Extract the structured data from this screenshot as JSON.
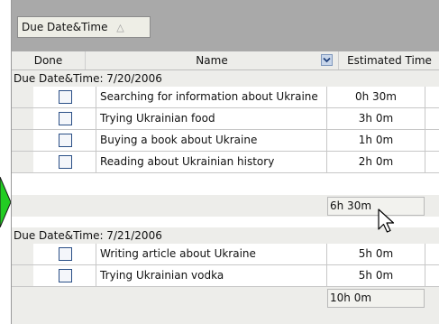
{
  "group_panel": {
    "chip_label": "Due Date&Time"
  },
  "columns": {
    "done": "Done",
    "name": "Name",
    "estimated": "Estimated Time"
  },
  "groups": [
    {
      "label": "Due Date&Time: 7/20/2006",
      "rows": [
        {
          "name": "Searching for information about Ukraine",
          "estimated": "0h 30m"
        },
        {
          "name": "Trying Ukrainian food",
          "estimated": "3h 0m"
        },
        {
          "name": "Buying a book about Ukraine",
          "estimated": "1h 0m"
        },
        {
          "name": "Reading about Ukrainian history",
          "estimated": "2h 0m"
        }
      ],
      "summary": "6h 30m"
    },
    {
      "label": "Due Date&Time: 7/21/2006",
      "rows": [
        {
          "name": "Writing article about Ukraine",
          "estimated": "5h 0m"
        },
        {
          "name": "Trying Ukrainian vodka",
          "estimated": "5h 0m"
        }
      ],
      "summary": "10h 0m"
    }
  ],
  "colors": {
    "indicator_arrow": "#22cc22",
    "group_panel_bg": "#a9a9a9",
    "checkbox_border": "#2a4f86"
  }
}
